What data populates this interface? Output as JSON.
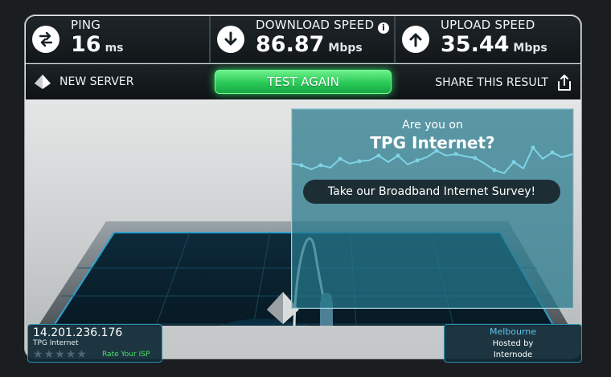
{
  "stats": {
    "ping": {
      "label": "PING",
      "value": "16",
      "unit": "ms",
      "icon": "exchange-arrows-icon"
    },
    "download": {
      "label": "DOWNLOAD SPEED",
      "value": "86.87",
      "unit": "Mbps",
      "icon": "arrow-down-icon",
      "info": "i"
    },
    "upload": {
      "label": "UPLOAD SPEED",
      "value": "35.44",
      "unit": "Mbps",
      "icon": "arrow-up-icon"
    }
  },
  "actions": {
    "new_server": "NEW SERVER",
    "test_again": "TEST AGAIN",
    "share": "SHARE THIS RESULT"
  },
  "survey": {
    "question": "Are you on",
    "isp": "TPG Internet?",
    "button": "Take our Broadband Internet Survey!"
  },
  "client": {
    "ip": "14.201.236.176",
    "isp": "TPG Internet",
    "rating_stars": 5,
    "rate_label": "Rate Your ISP"
  },
  "server": {
    "city": "Melbourne",
    "hosted_by": "Hosted by",
    "host": "Internode"
  },
  "colors": {
    "accent_green": "#29c957",
    "panel_blue": "#2f93b1",
    "city_blue": "#5cc4e8",
    "rate_green": "#48e06a"
  }
}
